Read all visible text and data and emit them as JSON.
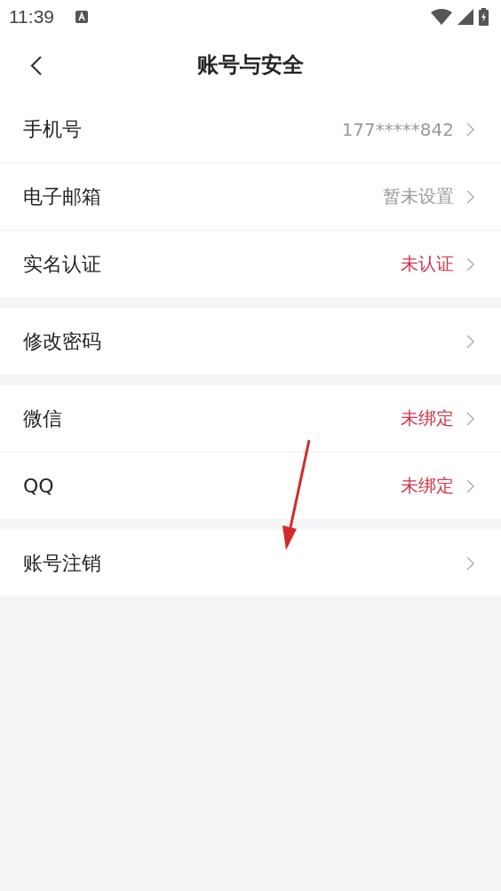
{
  "status_bar": {
    "time": "11:39"
  },
  "header": {
    "title": "账号与安全"
  },
  "groups": [
    {
      "rows": [
        {
          "label": "手机号",
          "value": "177*****842",
          "alert": false
        },
        {
          "label": "电子邮箱",
          "value": "暂未设置",
          "alert": false
        },
        {
          "label": "实名认证",
          "value": "未认证",
          "alert": true
        }
      ]
    },
    {
      "rows": [
        {
          "label": "修改密码"
        }
      ]
    },
    {
      "rows": [
        {
          "label": "微信",
          "value": "未绑定",
          "alert": true
        },
        {
          "label": "QQ",
          "value": "未绑定",
          "alert": true
        }
      ]
    },
    {
      "rows": [
        {
          "label": "账号注销"
        }
      ]
    }
  ]
}
